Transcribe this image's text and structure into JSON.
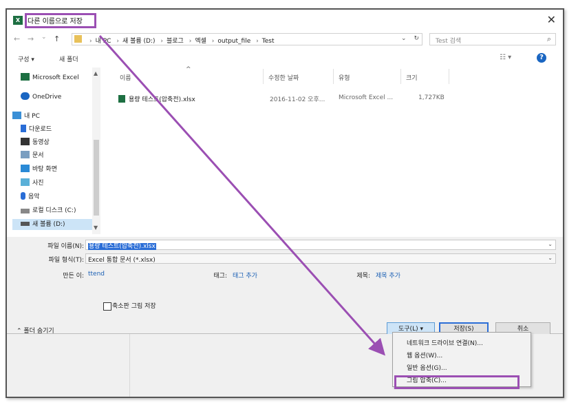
{
  "window": {
    "app_icon": "X",
    "title": "다른 이름으로 저장",
    "close_icon": "✕"
  },
  "nav": {
    "back_icon": "←",
    "forward_icon": "→",
    "recent_icon": "⌄",
    "up_icon": "↑",
    "breadcrumbs": [
      "내 PC",
      "새 볼륨 (D:)",
      "블로그",
      "엑셀",
      "output_file",
      "Test"
    ],
    "dropdown_icon": "⌄",
    "refresh_icon": "↻",
    "search_placeholder": "Test 검색",
    "search_icon": "⌕"
  },
  "toolbar": {
    "organize": "구성 ▾",
    "new_folder": "새 폴더",
    "view_icon": "☷ ▾",
    "help_icon": "?"
  },
  "sidebar": {
    "items": [
      {
        "label": "Microsoft Excel",
        "icon": "excel-icon",
        "color": "#1d6f42"
      },
      {
        "label": "OneDrive",
        "icon": "cloud-icon",
        "color": "#1a66c2"
      },
      {
        "label": "내 PC",
        "icon": "computer-icon",
        "color": "#3a8fd6"
      },
      {
        "label": "다운로드",
        "icon": "download-icon",
        "color": "#2a6dd6"
      },
      {
        "label": "동영상",
        "icon": "video-icon",
        "color": "#333333"
      },
      {
        "label": "문서",
        "icon": "document-icon",
        "color": "#7a9ec0"
      },
      {
        "label": "바탕 화면",
        "icon": "desktop-icon",
        "color": "#2a8ad6"
      },
      {
        "label": "사진",
        "icon": "picture-icon",
        "color": "#5ab0d8"
      },
      {
        "label": "음악",
        "icon": "music-icon",
        "color": "#2a6dd6"
      },
      {
        "label": "로컬 디스크 (C:)",
        "icon": "drive-icon",
        "color": "#888888"
      },
      {
        "label": "새 볼륨 (D:)",
        "icon": "drive-icon",
        "color": "#555555"
      }
    ]
  },
  "file_list": {
    "columns": [
      "이름",
      "수정한 날짜",
      "유형",
      "크기"
    ],
    "rows": [
      {
        "name": "용량 테스트(압축전).xlsx",
        "modified": "2016-11-02 오후...",
        "type": "Microsoft Excel ...",
        "size": "1,727KB"
      }
    ]
  },
  "form": {
    "filename_label": "파일 이름(N):",
    "filename_value": "용량 테스트(압축전).xlsx",
    "filetype_label": "파일 형식(T):",
    "filetype_value": "Excel 통합 문서 (*.xlsx)",
    "author_label": "만든 이:",
    "author_value": "ttend",
    "tags_label": "태그:",
    "tags_value": "태그 추가",
    "title_label": "제목:",
    "title_value": "제목 추가",
    "thumbnail_label": "축소판 그림 저장",
    "hide_folders": "폴더 숨기기"
  },
  "buttons": {
    "tools": "도구(L) ▾",
    "save": "저장(S)",
    "cancel": "취소"
  },
  "tools_menu": {
    "items": [
      "네트워크 드라이브 연결(N)...",
      "웹 옵션(W)...",
      "일반 옵션(G)...",
      "그림 압축(C)..."
    ]
  },
  "colors": {
    "annotation": "#9b4fb3",
    "selection": "#2a6dd6"
  }
}
